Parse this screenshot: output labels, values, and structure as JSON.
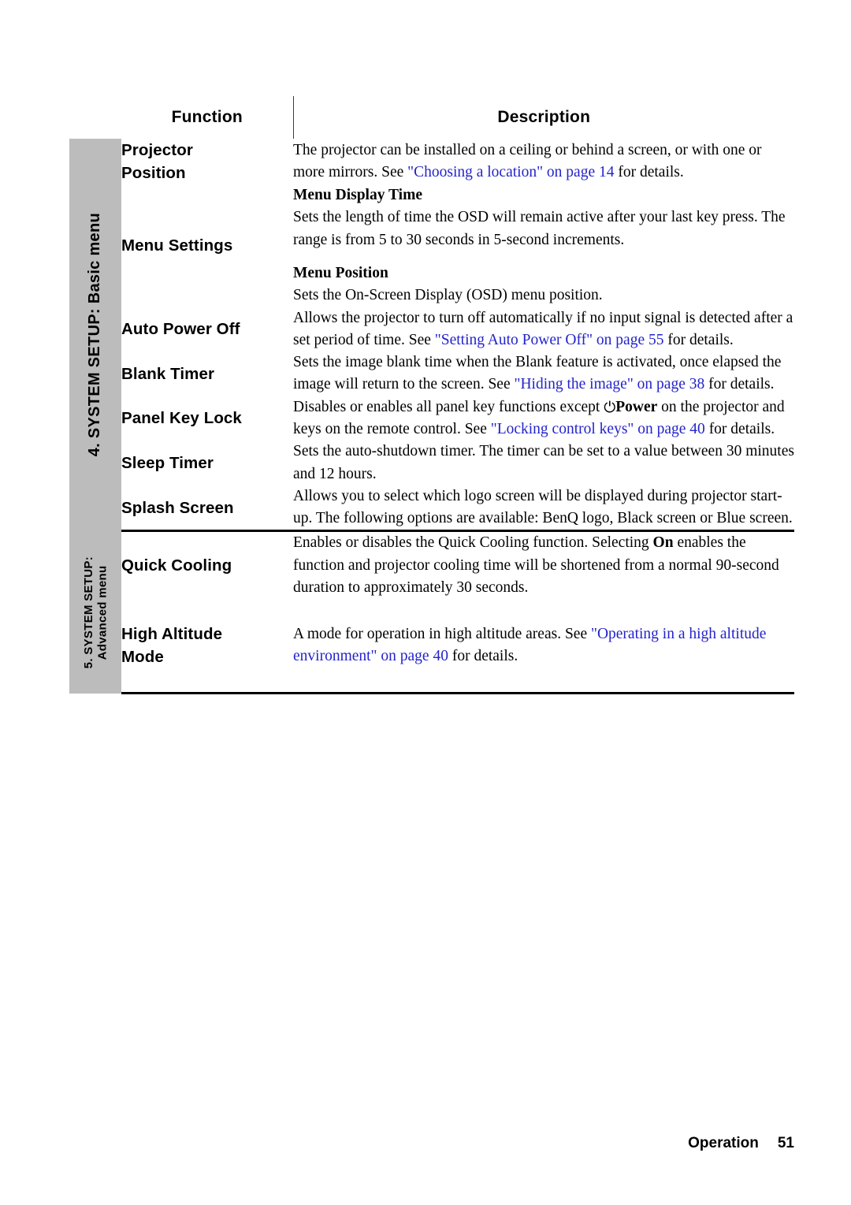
{
  "document": {
    "table": {
      "columns": {
        "function_header": "Function",
        "description_header": "Description"
      },
      "sections": [
        {
          "side_label": "4. SYSTEM SETUP: Basic menu",
          "rows": [
            {
              "function": "Projector Position",
              "function_line1": "Projector",
              "function_line2": "Position",
              "description_plain": "The projector can be installed on a ceiling or behind a screen, or with one or more mirrors. See \"Choosing a location\" on page 14 for details.",
              "parts": {
                "text_before": "The projector can be installed on a ceiling or behind a screen, or with one or more mirrors. See ",
                "link_text": "\"Choosing a location\" on page 14",
                "text_after": " for details."
              }
            },
            {
              "function": "Menu Settings",
              "sub_heading_1": "Menu Display Time",
              "sub_text_1": "Sets the length of time the OSD will remain active after your last key press. The range is from 5 to 30 seconds in 5-second increments.",
              "sub_heading_2": "Menu Position",
              "sub_text_2": "Sets the On-Screen Display (OSD) menu position."
            },
            {
              "function": "Auto Power Off",
              "description_plain": "Allows the projector to turn off automatically if no input signal is detected after a set period of time. See \"Setting Auto Power Off\" on page 55 for details.",
              "parts": {
                "text_before": "Allows the projector to turn off automatically if no input signal is detected after a set period of time. See ",
                "link_text": "\"Setting Auto Power Off\" on page 55",
                "text_after": " for details."
              }
            },
            {
              "function": "Blank Timer",
              "description_plain": "Sets the image blank time when the Blank feature is activated, once elapsed the image will return to the screen. See \"Hiding the image\" on page 38 for details.",
              "parts": {
                "text_before": "Sets the image blank time when the Blank feature is activated, once elapsed the image will return to the screen. See ",
                "link_text": "\"Hiding the image\" on page 38",
                "text_after": " for details."
              }
            },
            {
              "function": "Panel Key Lock",
              "description_plain": "Disables or enables all panel key functions except ⏻ Power on the projector and keys on the remote control. See \"Locking control keys\" on page 40 for details.",
              "parts": {
                "text_before": "Disables or enables all panel key functions except ",
                "power_icon": "⏻",
                "power_label": "Power",
                "text_mid": " on the projector and keys on the remote control. See ",
                "link_text": "\"Locking control keys\" on page 40",
                "text_after": " for details."
              }
            },
            {
              "function": "Sleep Timer",
              "description_plain": "Sets the auto-shutdown timer. The timer can be set to a value between 30 minutes and 12 hours."
            },
            {
              "function": "Splash Screen",
              "description_plain": "Allows you to select which logo screen will be displayed during projector start-up. The following options are available: BenQ logo, Black screen or Blue screen."
            }
          ]
        },
        {
          "side_label_line1": "5. SYSTEM SETUP:",
          "side_label_line2": "Advanced menu",
          "rows": [
            {
              "function": "Quick Cooling",
              "description_plain": "Enables or disables the Quick Cooling function. Selecting On enables the function and projector cooling time will be shortened from a normal 90-second duration to approximately 30 seconds.",
              "parts": {
                "text_before": "Enables or disables the Quick Cooling function. Selecting ",
                "bold_word": "On",
                "text_after": " enables the function and projector cooling time will be shortened from a normal 90-second duration to approximately 30 seconds."
              }
            },
            {
              "function": "High Altitude Mode",
              "function_line1": "High Altitude",
              "function_line2": "Mode",
              "description_plain": "A mode for operation in high altitude areas. See \"Operating in a high altitude environment\" on page 40 for details.",
              "parts": {
                "text_before": "A mode for operation in high altitude areas. See ",
                "link_text": "\"Operating in a high altitude environment\" on page 40",
                "text_after": " for details."
              }
            }
          ]
        }
      ]
    },
    "footer": {
      "label": "Operation",
      "page_number": "51"
    },
    "colors": {
      "link": "#2323cc",
      "side_column": "#bcbcbc",
      "rule": "#000000"
    }
  }
}
